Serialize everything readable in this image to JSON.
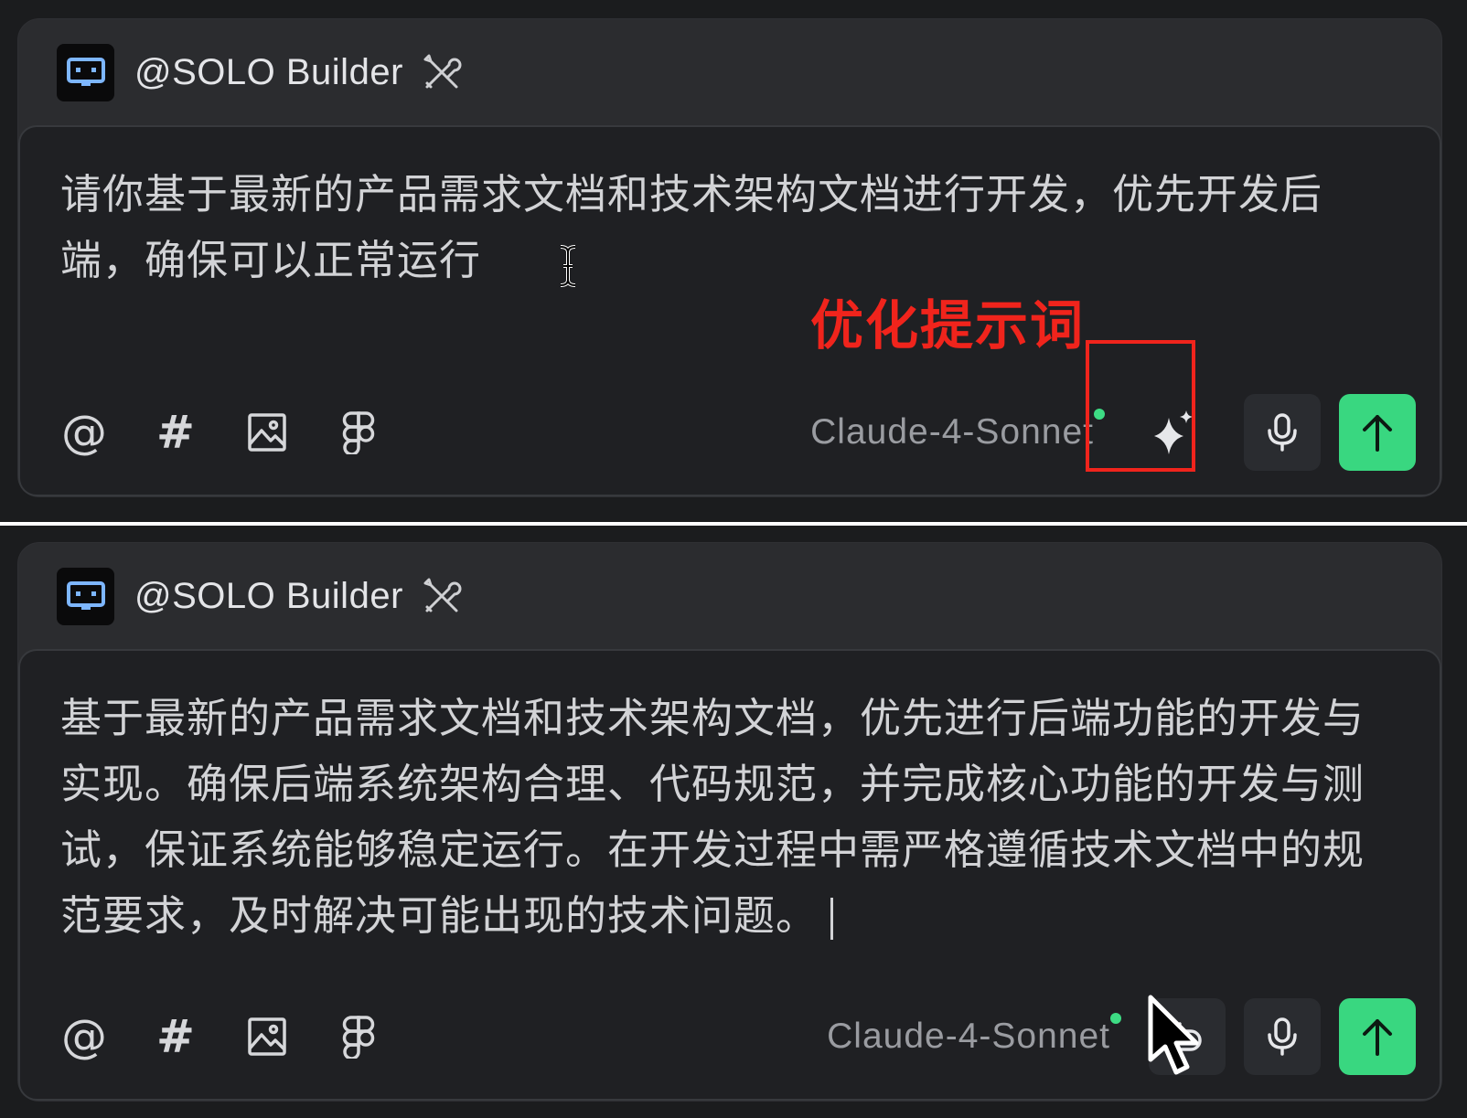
{
  "accent_color": "#39d780",
  "annotation_color": "#f0241c",
  "panels": [
    {
      "agent": {
        "avatar_icon": "robot-screen-icon",
        "name": "@SOLO Builder",
        "tools_icon": "tools-icon"
      },
      "prompt": "请你基于最新的产品需求文档和技术架构文档进行开发，优先开发后端，确保可以正常运行",
      "toolbar": {
        "mention_icon": "at-icon",
        "hash_icon": "hash-icon",
        "image_icon": "image-icon",
        "figma_icon": "figma-icon",
        "model": "Claude-4-Sonnet",
        "optimize_icon": "sparkle-icon",
        "voice_icon": "microphone-icon",
        "send_icon": "arrow-up-icon"
      },
      "annotation": "优化提示词"
    },
    {
      "agent": {
        "avatar_icon": "robot-screen-icon",
        "name": "@SOLO Builder",
        "tools_icon": "tools-icon"
      },
      "prompt": "基于最新的产品需求文档和技术架构文档，优先进行后端功能的开发与实现。确保后端系统架构合理、代码规范，并完成核心功能的开发与测试，保证系统能够稳定运行。在开发过程中需严格遵循技术文档中的规范要求，及时解决可能出现的技术问题。",
      "toolbar": {
        "mention_icon": "at-icon",
        "hash_icon": "hash-icon",
        "image_icon": "image-icon",
        "figma_icon": "figma-icon",
        "model": "Claude-4-Sonnet",
        "undo_icon": "undo-icon",
        "voice_icon": "microphone-icon",
        "send_icon": "arrow-up-icon"
      }
    }
  ]
}
